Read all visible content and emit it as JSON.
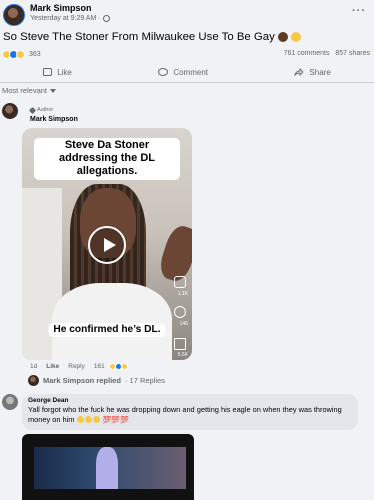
{
  "post": {
    "author": "Mark Simpson",
    "meta": "Yesterday at 9:29 AM ·",
    "title": "So Steve The Stoner From Milwaukee Use To Be Gay",
    "reaction_count": "363",
    "comments": "761 comments",
    "shares": "857 shares",
    "actions": {
      "like": "Like",
      "comment": "Comment",
      "share": "Share"
    },
    "more_icon": "more-dots-icon"
  },
  "comments_filter": "Most relevant",
  "author_comment": {
    "tag": "Author",
    "author": "Mark Simpson",
    "video": {
      "caption_top": "Steve Da Stoner addressing the DL allegations.",
      "caption_bottom": "He confirmed he’s DL.",
      "side_counts": [
        "1.1K",
        "146",
        "5.5K"
      ]
    },
    "time": "1d",
    "like_label": "Like",
    "reply_label": "Reply",
    "reaction_count": "161",
    "reply_summary_who": "Mark Simpson replied",
    "reply_summary_count": "· 17 Replies"
  },
  "george": {
    "name": "George Dean",
    "text": "Yall forgot who the fuck he was dropping down and getting his eagle on when they was throwing money on him"
  },
  "colors": {
    "accent": "#1877f2",
    "secondary_text": "#65676b",
    "bubble": "#e4e6eb"
  }
}
